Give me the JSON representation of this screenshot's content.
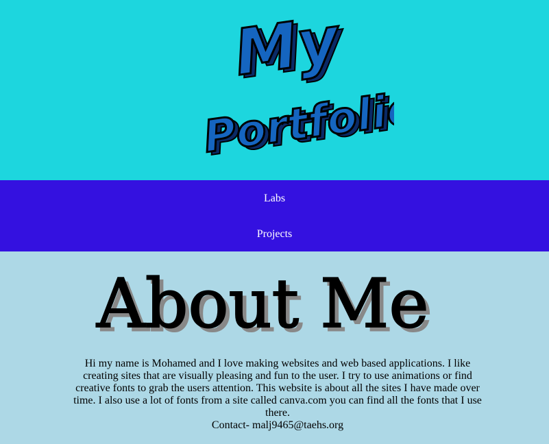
{
  "header": {
    "logo_line1": "My",
    "logo_line2": "Portfolio"
  },
  "nav": {
    "items": [
      {
        "label": "Labs"
      },
      {
        "label": "Projects"
      }
    ]
  },
  "main": {
    "heading": "About Me",
    "bio": "Hi my name is Mohamed and I love making websites and web based applications. I like creating sites that are visually pleasing and fun to the user. I try to use animations or find creative fonts to grab the users attention. This website is about all the sites I have made over time. I also use a lot of fonts from a site called canva.com you can find all the fonts that I use there.",
    "contact": "Contact- malj9465@taehs.org"
  },
  "colors": {
    "header_bg": "#1dd6de",
    "nav_bg": "#3411e0",
    "content_bg": "#add8e6",
    "logo_fill": "#1565c0"
  }
}
